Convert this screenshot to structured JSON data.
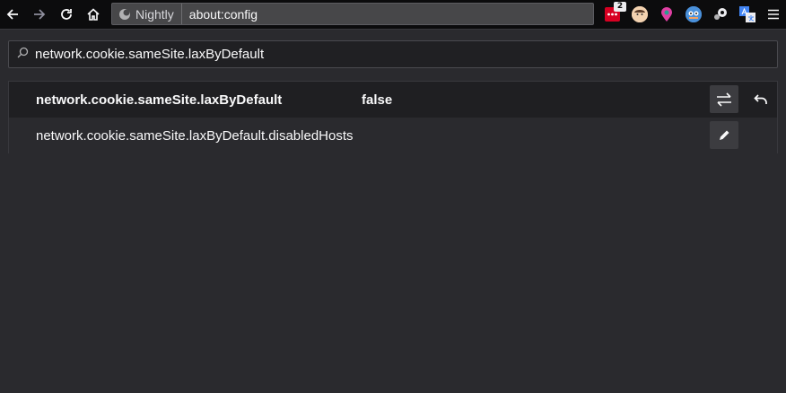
{
  "browser": {
    "identity_label": "Nightly",
    "url": "about:config",
    "extension_badge": "2"
  },
  "search": {
    "value": "network.cookie.sameSite.laxByDefault"
  },
  "prefs": [
    {
      "name": "network.cookie.sameSite.laxByDefault",
      "value": "false",
      "action": "toggle-icon",
      "modified": true
    },
    {
      "name": "network.cookie.sameSite.laxByDefault.disabledHosts",
      "value": "",
      "action": "edit-icon",
      "modified": false
    }
  ],
  "colors": {
    "background": "#2a2a2e",
    "toolbar": "#0c0c0d",
    "row_highlight": "#1f1f22",
    "button": "#3c3c40"
  }
}
